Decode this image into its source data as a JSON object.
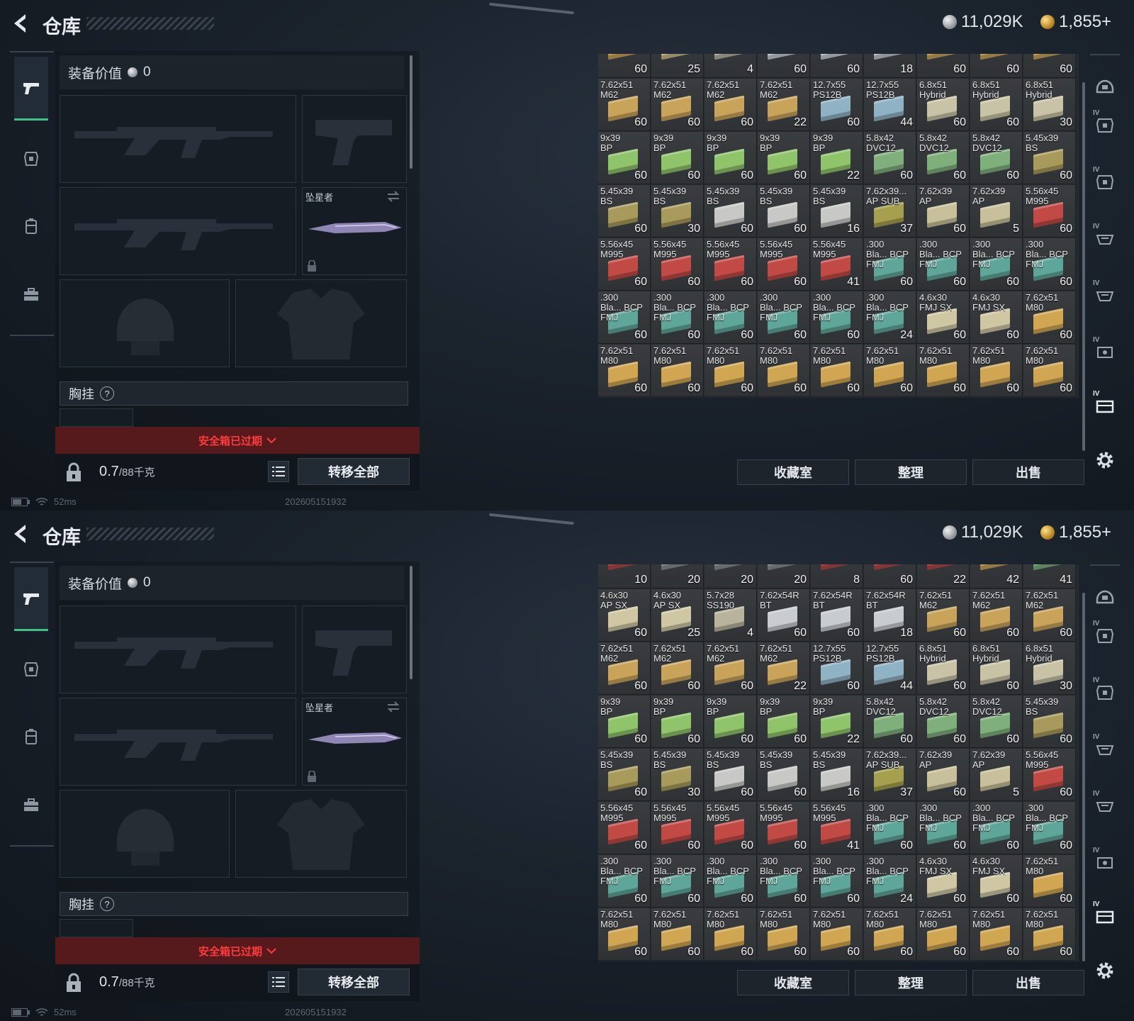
{
  "screens": [
    {
      "title": "仓库",
      "currency_silver": "11,029K",
      "currency_gold": "1,855+",
      "equip_value_label": "装备价值",
      "equip_value": "0",
      "knife_name": "坠星者",
      "chest_rig_label": "胸挂",
      "help_symbol": "?",
      "safe_box_status": "安全箱已过期",
      "weight_value": "0.7",
      "weight_capacity": "/88千克",
      "transfer_all": "转移全部",
      "buttons": [
        "收藏室",
        "整理",
        "出售"
      ],
      "ping": "52ms",
      "build": "202605151932",
      "top_row_qty": [
        "60",
        "25",
        "4",
        "60",
        "60",
        "18",
        "60",
        "60",
        "60"
      ],
      "top_row_colors": [
        "#c9a35a",
        "#c9b88a",
        "#b7b39c",
        "#c8ccd0",
        "#c8ccd0",
        "#c0c6cc",
        "#c9a35a",
        "#c9a35a",
        "#c9a35a"
      ],
      "rows": [
        [
          [
            "7.62x51 M62",
            "60",
            "#c9a35a"
          ],
          [
            "7.62x51 M62",
            "60",
            "#c9a35a"
          ],
          [
            "7.62x51 M62",
            "60",
            "#c9a35a"
          ],
          [
            "7.62x51 M62",
            "22",
            "#c9a35a"
          ],
          [
            "12.7x55 PS12B",
            "60",
            "#8fb2c4"
          ],
          [
            "12.7x55 PS12B",
            "44",
            "#8fb2c4"
          ],
          [
            "6.8x51 Hybrid",
            "60",
            "#c8c3a6"
          ],
          [
            "6.8x51 Hybrid",
            "60",
            "#c8c3a6"
          ],
          [
            "6.8x51 Hybrid",
            "30",
            "#c8c3a6"
          ]
        ],
        [
          [
            "9x39 BP",
            "60",
            "#8fc46a"
          ],
          [
            "9x39 BP",
            "60",
            "#8fc46a"
          ],
          [
            "9x39 BP",
            "60",
            "#8fc46a"
          ],
          [
            "9x39 BP",
            "60",
            "#8fc46a"
          ],
          [
            "9x39 BP",
            "22",
            "#8fc46a"
          ],
          [
            "5.8x42 DVC12",
            "60",
            "#7fb07c"
          ],
          [
            "5.8x42 DVC12",
            "60",
            "#7fb07c"
          ],
          [
            "5.8x42 DVC12",
            "60",
            "#7fb07c"
          ],
          [
            "5.45x39 BS",
            "60",
            "#a79a5a"
          ]
        ],
        [
          [
            "5.45x39 BS",
            "60",
            "#a79a5a"
          ],
          [
            "5.45x39 BS",
            "30",
            "#a79a5a"
          ],
          [
            "5.45x39 BS",
            "60",
            "#c8c9c6"
          ],
          [
            "5.45x39 BS",
            "60",
            "#c8c9c6"
          ],
          [
            "5.45x39 BS",
            "16",
            "#c8c9c6"
          ],
          [
            "7.62x39... AP SUB",
            "37",
            "#a6a04e"
          ],
          [
            "7.62x39 AP",
            "60",
            "#c8c09a"
          ],
          [
            "7.62x39 AP",
            "5",
            "#c8c09a"
          ],
          [
            "5.56x45 M995",
            "60",
            "#c24a44"
          ]
        ],
        [
          [
            "5.56x45 M995",
            "60",
            "#c24a44"
          ],
          [
            "5.56x45 M995",
            "60",
            "#c24a44"
          ],
          [
            "5.56x45 M995",
            "60",
            "#c24a44"
          ],
          [
            "5.56x45 M995",
            "60",
            "#c24a44"
          ],
          [
            "5.56x45 M995",
            "41",
            "#c24a44"
          ],
          [
            ".300 Bla... BCP FMJ",
            "60",
            "#5fa69a"
          ],
          [
            ".300 Bla... BCP FMJ",
            "60",
            "#5fa69a"
          ],
          [
            ".300 Bla... BCP FMJ",
            "60",
            "#5fa69a"
          ],
          [
            ".300 Bla... BCP FMJ",
            "60",
            "#5fa69a"
          ]
        ],
        [
          [
            ".300 Bla... BCP FMJ",
            "60",
            "#5fa69a"
          ],
          [
            ".300 Bla... BCP FMJ",
            "60",
            "#5fa69a"
          ],
          [
            ".300 Bla... BCP FMJ",
            "60",
            "#5fa69a"
          ],
          [
            ".300 Bla... BCP FMJ",
            "60",
            "#5fa69a"
          ],
          [
            ".300 Bla... BCP FMJ",
            "60",
            "#5fa69a"
          ],
          [
            ".300 Bla... BCP FMJ",
            "24",
            "#5fa69a"
          ],
          [
            "4.6x30 FMJ SX",
            "60",
            "#cfc7a4"
          ],
          [
            "4.6x30 FMJ SX",
            "60",
            "#cfc7a4"
          ],
          [
            "7.62x51 M80",
            "60",
            "#d1a652"
          ]
        ],
        [
          [
            "7.62x51 M80",
            "60",
            "#d1a652"
          ],
          [
            "7.62x51 M80",
            "60",
            "#d1a652"
          ],
          [
            "7.62x51 M80",
            "60",
            "#d1a652"
          ],
          [
            "7.62x51 M80",
            "60",
            "#d1a652"
          ],
          [
            "7.62x51 M80",
            "60",
            "#d1a652"
          ],
          [
            "7.62x51 M80",
            "60",
            "#d1a652"
          ],
          [
            "7.62x51 M80",
            "60",
            "#d1a652"
          ],
          [
            "7.62x51 M80",
            "60",
            "#d1a652"
          ],
          [
            "7.62x51 M80",
            "60",
            "#d1a652"
          ]
        ]
      ]
    },
    {
      "title": "仓库",
      "currency_silver": "11,029K",
      "currency_gold": "1,855+",
      "equip_value_label": "装备价值",
      "equip_value": "0",
      "knife_name": "坠星者",
      "chest_rig_label": "胸挂",
      "help_symbol": "?",
      "safe_box_status": "安全箱已过期",
      "weight_value": "0.7",
      "weight_capacity": "/88千克",
      "transfer_all": "转移全部",
      "buttons": [
        "收藏室",
        "整理",
        "出售"
      ],
      "ping": "52ms",
      "build": "202605151932",
      "top_row_qty": [
        "10",
        "20",
        "20",
        "20",
        "8",
        "60",
        "22",
        "42",
        "41"
      ],
      "top_row_colors": [
        "#b0484a",
        "#8a8f94",
        "#8a8f94",
        "#8a8f94",
        "#b0484a",
        "#b0484a",
        "#b0484a",
        "#c9a35a",
        "#7fb07c"
      ],
      "rows": [
        [
          [
            "4.6x30 AP SX",
            "60",
            "#cfc7a4"
          ],
          [
            "4.6x30 AP SX",
            "25",
            "#cfc7a4"
          ],
          [
            "5.7x28 SS190",
            "4",
            "#b7b39c"
          ],
          [
            "7.62x54R BT",
            "60",
            "#c8ccd0"
          ],
          [
            "7.62x54R BT",
            "60",
            "#c8ccd0"
          ],
          [
            "7.62x54R BT",
            "18",
            "#c8ccd0"
          ],
          [
            "7.62x51 M62",
            "60",
            "#c9a35a"
          ],
          [
            "7.62x51 M62",
            "60",
            "#c9a35a"
          ],
          [
            "7.62x51 M62",
            "60",
            "#c9a35a"
          ]
        ],
        [
          [
            "7.62x51 M62",
            "60",
            "#c9a35a"
          ],
          [
            "7.62x51 M62",
            "60",
            "#c9a35a"
          ],
          [
            "7.62x51 M62",
            "60",
            "#c9a35a"
          ],
          [
            "7.62x51 M62",
            "22",
            "#c9a35a"
          ],
          [
            "12.7x55 PS12B",
            "60",
            "#8fb2c4"
          ],
          [
            "12.7x55 PS12B",
            "44",
            "#8fb2c4"
          ],
          [
            "6.8x51 Hybrid",
            "60",
            "#c8c3a6"
          ],
          [
            "6.8x51 Hybrid",
            "60",
            "#c8c3a6"
          ],
          [
            "6.8x51 Hybrid",
            "30",
            "#c8c3a6"
          ]
        ],
        [
          [
            "9x39 BP",
            "60",
            "#8fc46a"
          ],
          [
            "9x39 BP",
            "60",
            "#8fc46a"
          ],
          [
            "9x39 BP",
            "60",
            "#8fc46a"
          ],
          [
            "9x39 BP",
            "60",
            "#8fc46a"
          ],
          [
            "9x39 BP",
            "22",
            "#8fc46a"
          ],
          [
            "5.8x42 DVC12",
            "60",
            "#7fb07c"
          ],
          [
            "5.8x42 DVC12",
            "60",
            "#7fb07c"
          ],
          [
            "5.8x42 DVC12",
            "60",
            "#7fb07c"
          ],
          [
            "5.45x39 BS",
            "60",
            "#a79a5a"
          ]
        ],
        [
          [
            "5.45x39 BS",
            "60",
            "#a79a5a"
          ],
          [
            "5.45x39 BS",
            "30",
            "#a79a5a"
          ],
          [
            "5.45x39 BS",
            "60",
            "#c8c9c6"
          ],
          [
            "5.45x39 BS",
            "60",
            "#c8c9c6"
          ],
          [
            "5.45x39 BS",
            "16",
            "#c8c9c6"
          ],
          [
            "7.62x39... AP SUB",
            "37",
            "#a6a04e"
          ],
          [
            "7.62x39 AP",
            "60",
            "#c8c09a"
          ],
          [
            "7.62x39 AP",
            "5",
            "#c8c09a"
          ],
          [
            "5.56x45 M995",
            "60",
            "#c24a44"
          ]
        ],
        [
          [
            "5.56x45 M995",
            "60",
            "#c24a44"
          ],
          [
            "5.56x45 M995",
            "60",
            "#c24a44"
          ],
          [
            "5.56x45 M995",
            "60",
            "#c24a44"
          ],
          [
            "5.56x45 M995",
            "60",
            "#c24a44"
          ],
          [
            "5.56x45 M995",
            "41",
            "#c24a44"
          ],
          [
            ".300 Bla... BCP FMJ",
            "60",
            "#5fa69a"
          ],
          [
            ".300 Bla... BCP FMJ",
            "60",
            "#5fa69a"
          ],
          [
            ".300 Bla... BCP FMJ",
            "60",
            "#5fa69a"
          ],
          [
            ".300 Bla... BCP FMJ",
            "60",
            "#5fa69a"
          ]
        ],
        [
          [
            ".300 Bla... BCP FMJ",
            "60",
            "#5fa69a"
          ],
          [
            ".300 Bla... BCP FMJ",
            "60",
            "#5fa69a"
          ],
          [
            ".300 Bla... BCP FMJ",
            "60",
            "#5fa69a"
          ],
          [
            ".300 Bla... BCP FMJ",
            "60",
            "#5fa69a"
          ],
          [
            ".300 Bla... BCP FMJ",
            "60",
            "#5fa69a"
          ],
          [
            ".300 Bla... BCP FMJ",
            "24",
            "#5fa69a"
          ],
          [
            "4.6x30 FMJ SX",
            "60",
            "#cfc7a4"
          ],
          [
            "4.6x30 FMJ SX",
            "60",
            "#cfc7a4"
          ],
          [
            "7.62x51 M80",
            "60",
            "#d1a652"
          ]
        ],
        [
          [
            "7.62x51 M80",
            "60",
            "#d1a652"
          ],
          [
            "7.62x51 M80",
            "60",
            "#d1a652"
          ],
          [
            "7.62x51 M80",
            "60",
            "#d1a652"
          ],
          [
            "7.62x51 M80",
            "60",
            "#d1a652"
          ],
          [
            "7.62x51 M80",
            "60",
            "#d1a652"
          ],
          [
            "7.62x51 M80",
            "60",
            "#d1a652"
          ],
          [
            "7.62x51 M80",
            "60",
            "#d1a652"
          ],
          [
            "7.62x51 M80",
            "60",
            "#d1a652"
          ],
          [
            "7.62x51 M80",
            "60",
            "#d1a652"
          ]
        ]
      ]
    }
  ]
}
